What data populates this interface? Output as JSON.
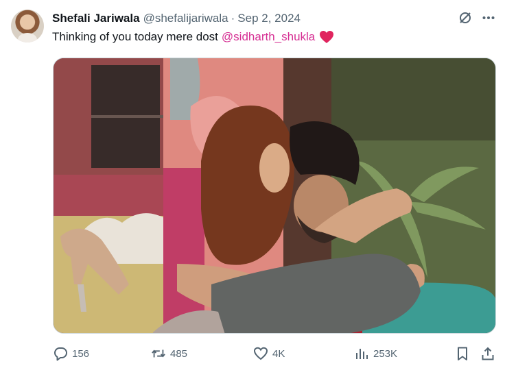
{
  "author": {
    "display_name": "Shefali Jariwala",
    "handle": "@shefalijariwala",
    "separator": "·",
    "date": "Sep 2, 2024"
  },
  "tweet": {
    "text": "Thinking of you today mere dost",
    "mention": "@sidharth_shukla",
    "emoji": "red-heart"
  },
  "header_icons": [
    "grok-icon",
    "more-icon"
  ],
  "actions": {
    "replies": "156",
    "reposts": "485",
    "likes": "4K",
    "views": "253K"
  },
  "colors": {
    "text": "#0f1419",
    "secondary": "#536471",
    "mention": "#d62f93",
    "heart": "#e0245e",
    "border": "#cfd9de"
  }
}
